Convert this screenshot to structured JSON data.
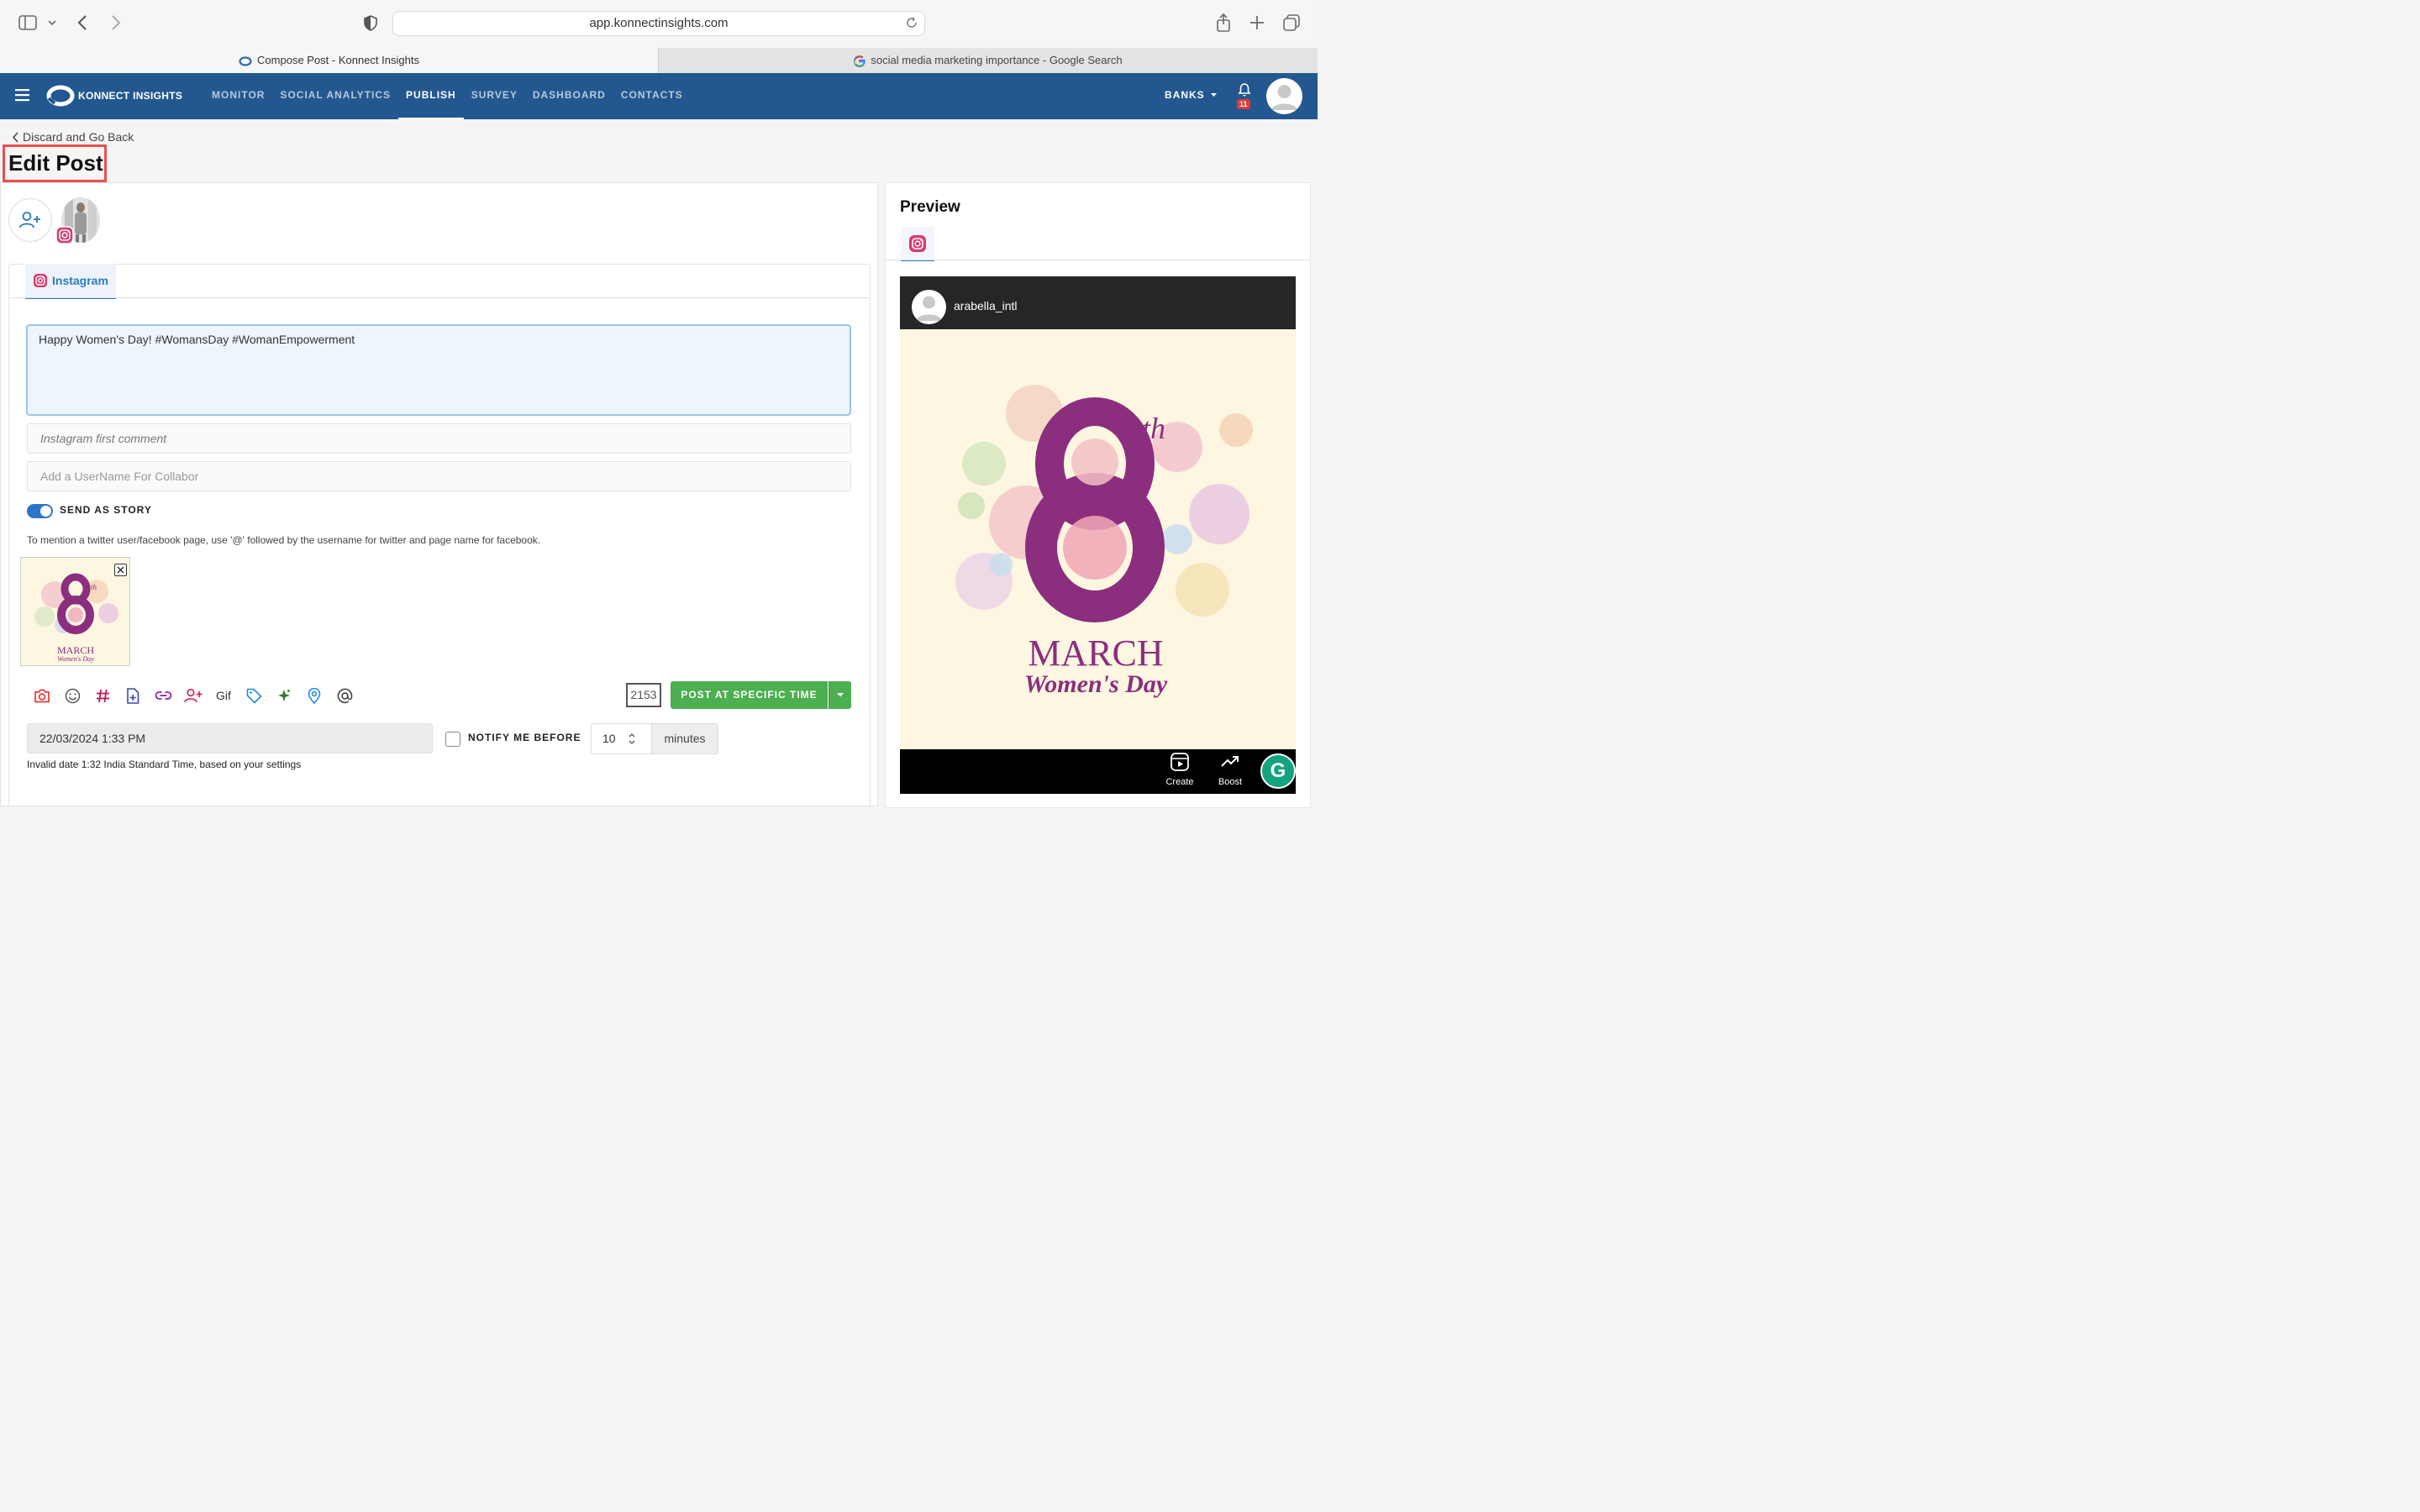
{
  "browser": {
    "url": "app.konnectinsights.com",
    "tabs": [
      {
        "title": "Compose Post - Konnect Insights",
        "active": true
      },
      {
        "title": "social media marketing importance - Google Search",
        "active": false
      }
    ]
  },
  "navbar": {
    "brand": "KONNECT INSIGHTS",
    "items": [
      "MONITOR",
      "SOCIAL ANALYTICS",
      "PUBLISH",
      "SURVEY",
      "DASHBOARD",
      "CONTACTS"
    ],
    "active_item": "PUBLISH",
    "account": "BANKS",
    "notification_count": "11",
    "bg_color": "#23578f"
  },
  "page": {
    "back_label": "Discard and Go Back",
    "title": "Edit Post"
  },
  "editor": {
    "tab_label": "Instagram",
    "caption": "Happy Women's Day! #WomansDay #WomanEmpowerment",
    "first_comment_placeholder": "Instagram first comment",
    "collab_placeholder": "Add a UserName For Collabor",
    "send_as_story_label": "SEND AS STORY",
    "send_as_story": true,
    "mention_hint": "To mention a twitter user/facebook page, use '@' followed by the username for twitter and page name for facebook.",
    "toolbar": [
      "camera-icon",
      "emoji-icon",
      "hashtag-icon",
      "add-file-icon",
      "link-icon",
      "add-user-icon",
      "Gif",
      "tag-icon",
      "sparkle-icon",
      "location-icon",
      "at-icon"
    ],
    "gif_label": "Gif",
    "char_count": "2153",
    "post_button": "POST AT SPECIFIC TIME",
    "schedule_datetime": "22/03/2024 1:33 PM",
    "notify_label": "NOTIFY ME BEFORE",
    "notify_checked": false,
    "notify_minutes": "10",
    "minutes_label": "minutes",
    "invalid_date_note": "Invalid date 1:32 India Standard Time, based on your settings",
    "post_button_color": "#4caf50"
  },
  "image": {
    "number": "8",
    "suffix": "th",
    "month": "MARCH",
    "caption": "Women's Day"
  },
  "preview": {
    "title": "Preview",
    "username": "arabella_intl",
    "footer": [
      "Create",
      "Boost"
    ]
  }
}
